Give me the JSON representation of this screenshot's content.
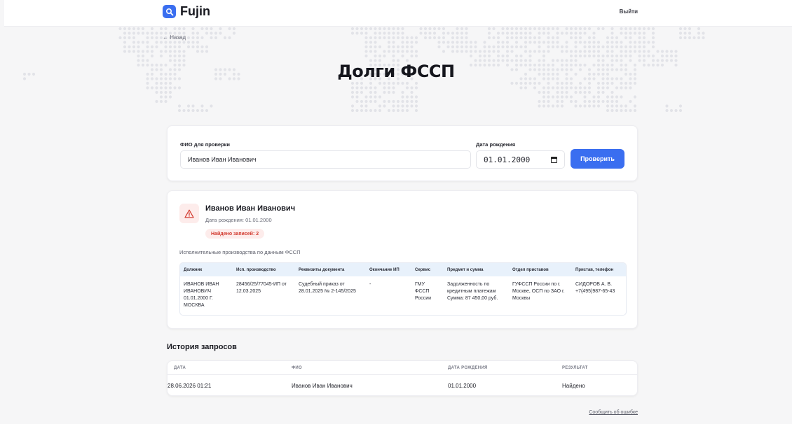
{
  "header": {
    "app_name": "Fujin",
    "logout_label": "Выйти"
  },
  "hero": {
    "back_label": "← Назад",
    "title": "Долги ФССП"
  },
  "search": {
    "name_label": "ФИО для проверки",
    "name_value": "Иванов Иван Иванович",
    "dob_label": "Дата рождения",
    "dob_value": "01.01.2000",
    "submit_label": "Проверить"
  },
  "result": {
    "name": "Иванов Иван Иванович",
    "dob_line": "Дата рождения: 01.01.2000",
    "badge": "Найдено записей: 2",
    "caption": "Исполнительные производства по данным ФССП",
    "columns": [
      "Должник",
      "Исп. производство",
      "Реквизиты документа",
      "Окончание ИП",
      "Сервис",
      "Предмет и сумма",
      "Отдел приставов",
      "Пристав, телефон"
    ],
    "rows": [
      [
        "ИВАНОВ ИВАН ИВАНОВИЧ 01.01.2000 Г. МОСКВА",
        "28456/25/77045-ИП от 12.03.2025",
        "Судебный приказ от 28.01.2025 № 2-145/2025",
        "-",
        "ГМУ ФССП России",
        "Задолженность по кредитным платежам Сумма: 87 450,00 руб.",
        "ГУФССП России по г. Москве, ОСП по ЗАО г. Москвы",
        "СИДОРОВ А. В. +7(495)987-65-43"
      ]
    ]
  },
  "history": {
    "title": "История запросов",
    "columns": [
      "ДАТА",
      "ФИО",
      "ДАТА РОЖДЕНИЯ",
      "РЕЗУЛЬТАТ"
    ],
    "rows": [
      [
        "28.06.2026 01:21",
        "Иванов Иван Иванович",
        "01.01.2000",
        "Найдено"
      ]
    ]
  },
  "footer": {
    "report_label": "Сообщить об ошибке"
  },
  "colors": {
    "accent": "#3a6ef0",
    "danger": "#d23a2f",
    "table_header": "#e8f1fb"
  }
}
